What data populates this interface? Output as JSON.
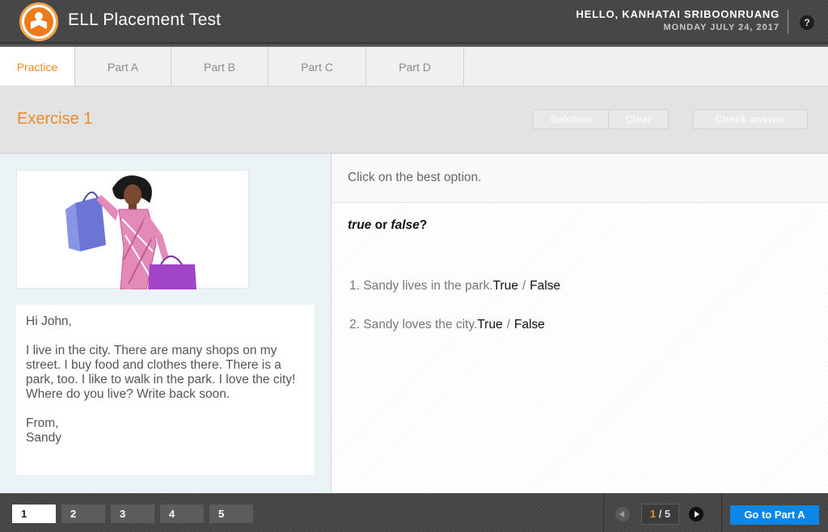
{
  "header": {
    "app_title": "ELL Placement Test",
    "greeting_prefix": "HELLO,",
    "user_name": "KANHATAI SRIBOONRUANG",
    "date": "MONDAY JULY 24, 2017",
    "help_label": "?"
  },
  "tabs": [
    {
      "label": "Practice",
      "active": true
    },
    {
      "label": "Part A"
    },
    {
      "label": "Part B"
    },
    {
      "label": "Part C"
    },
    {
      "label": "Part D"
    }
  ],
  "exercise": {
    "title": "Exercise 1",
    "solution_label": "Solution",
    "clear_label": "Clear",
    "check_label": "Check answer"
  },
  "letter": {
    "greeting": "Hi John,",
    "body": "I live in the city. There are many shops on my street. I buy food and clothes there. There is a park, too. I like to walk in the park. I love the city! Where do you live? Write back soon.",
    "closing": "From,",
    "signature": "Sandy"
  },
  "task": {
    "instruction": "Click on the best option.",
    "question_true": "true",
    "question_or": " or ",
    "question_false": "false",
    "question_mark": "?",
    "items": [
      {
        "number": "1.",
        "text": "Sandy lives in the park.",
        "option_a": "True",
        "separator": "/",
        "option_b": "False"
      },
      {
        "number": "2.",
        "text": "Sandy loves the city.",
        "option_a": "True",
        "separator": "/",
        "option_b": "False"
      }
    ]
  },
  "footer": {
    "pages": [
      "1",
      "2",
      "3",
      "4",
      "5"
    ],
    "current_page": "1",
    "counter_sep": " / ",
    "total_pages": "5",
    "go_label": "Go to Part A"
  },
  "colors": {
    "accent_orange": "#ef8a25",
    "go_button_blue": "#0d87e6",
    "header_dark": "#4a4a4a"
  },
  "icons": {
    "logo": "person-reading-icon",
    "help": "question-mark-icon",
    "prev": "chevron-left-icon",
    "next": "chevron-right-icon"
  }
}
